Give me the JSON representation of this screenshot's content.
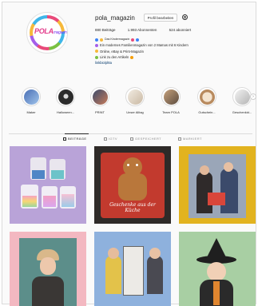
{
  "profile": {
    "username": "pola_magazin",
    "edit_label": "Profil bearbeiten",
    "avatar_logo": "POLA",
    "avatar_sub": "magazin",
    "stats": {
      "posts": "880 Beiträge",
      "followers": "1.993 Abonnenten",
      "following": "524 abonniert"
    },
    "bio": [
      "Das Kindermagazin",
      "Ein modernes Familienmagazin von 2 Mamas mit 6 Kindern",
      "Online, eBay & Print-Magazin",
      "Link zu den Artikeln",
      "linkbio/pl8a"
    ]
  },
  "highlights": [
    {
      "label": "Maker",
      "color": "#4a6fb5"
    },
    {
      "label": "Halloween...",
      "color": "#2b2b2b"
    },
    {
      "label": "PRINT",
      "color": "#3a4a6b"
    },
    {
      "label": "Unser Alltag",
      "color": "#d8d0c4"
    },
    {
      "label": "Team POLA",
      "color": "#c7a27c"
    },
    {
      "label": "Gutschein...",
      "color": "#b88a5e"
    },
    {
      "label": "Geschenkid...",
      "color": "#e8e8e8"
    }
  ],
  "tabs": [
    {
      "label": "BEITRÄGE",
      "active": true
    },
    {
      "label": "IGTV",
      "active": false
    },
    {
      "label": "GESPEICHERT",
      "active": false
    },
    {
      "label": "MARKIERT",
      "active": false
    }
  ],
  "posts": [
    {
      "caption": ""
    },
    {
      "caption": "Geschenke aus der Küche"
    },
    {
      "caption": ""
    },
    {
      "caption": ""
    },
    {
      "caption": ""
    },
    {
      "caption": ""
    }
  ]
}
